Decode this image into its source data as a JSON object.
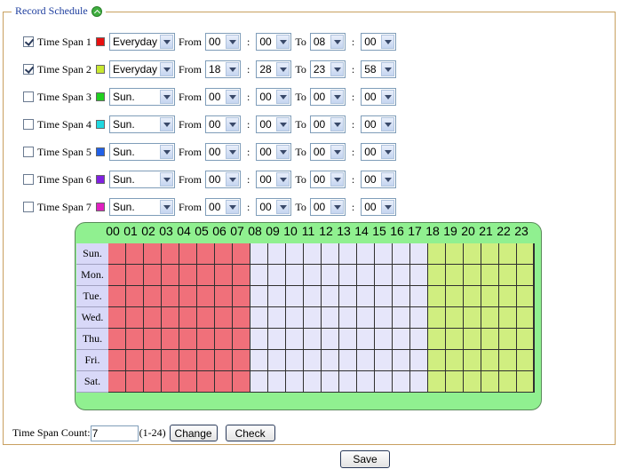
{
  "section": {
    "title": "Record Schedule",
    "icon": "collapse-up-icon"
  },
  "labels": {
    "from": "From",
    "to": "To",
    "colon": ":"
  },
  "time_spans": [
    {
      "label": "Time Span 1",
      "checked": true,
      "color": "#e81010",
      "day": "Everyday",
      "from_h": "00",
      "from_m": "00",
      "to_h": "08",
      "to_m": "00"
    },
    {
      "label": "Time Span 2",
      "checked": true,
      "color": "#c8e830",
      "day": "Everyday",
      "from_h": "18",
      "from_m": "28",
      "to_h": "23",
      "to_m": "58"
    },
    {
      "label": "Time Span 3",
      "checked": false,
      "color": "#20d020",
      "day": "Sun.",
      "from_h": "00",
      "from_m": "00",
      "to_h": "00",
      "to_m": "00"
    },
    {
      "label": "Time Span 4",
      "checked": false,
      "color": "#20d8e0",
      "day": "Sun.",
      "from_h": "00",
      "from_m": "00",
      "to_h": "00",
      "to_m": "00"
    },
    {
      "label": "Time Span 5",
      "checked": false,
      "color": "#2060e8",
      "day": "Sun.",
      "from_h": "00",
      "from_m": "00",
      "to_h": "00",
      "to_m": "00"
    },
    {
      "label": "Time Span 6",
      "checked": false,
      "color": "#8020e0",
      "day": "Sun.",
      "from_h": "00",
      "from_m": "00",
      "to_h": "00",
      "to_m": "00"
    },
    {
      "label": "Time Span 7",
      "checked": false,
      "color": "#e020c0",
      "day": "Sun.",
      "from_h": "00",
      "from_m": "00",
      "to_h": "00",
      "to_m": "00"
    }
  ],
  "schedule": {
    "hours": [
      "00",
      "01",
      "02",
      "03",
      "04",
      "05",
      "06",
      "07",
      "08",
      "09",
      "10",
      "11",
      "12",
      "13",
      "14",
      "15",
      "16",
      "17",
      "18",
      "19",
      "20",
      "21",
      "22",
      "23"
    ],
    "days": [
      "Sun.",
      "Mon.",
      "Tue.",
      "Wed.",
      "Thu.",
      "Fri.",
      "Sat."
    ],
    "colors": {
      "span1": "#f0707a",
      "span2": "#d0ee80",
      "empty": "#e6e6fa"
    },
    "span1_hours": [
      0,
      8
    ],
    "span2_hours": [
      18.47,
      24
    ]
  },
  "footer": {
    "count_label": "Time Span Count:",
    "count_value": "7",
    "count_range": "(1-24)",
    "change_label": "Change",
    "check_label": "Check",
    "save_label": "Save"
  }
}
